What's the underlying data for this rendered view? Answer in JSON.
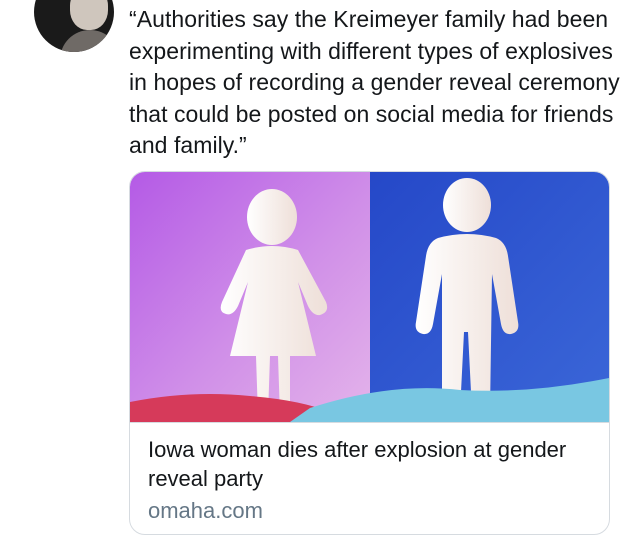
{
  "tweet": {
    "text": "“Authorities say the Kreimeyer family had been experimenting with different types of explosives in hopes of recording a gender reveal ceremony that could be posted on social media for friends and family.”"
  },
  "link_card": {
    "image_icon": "male-female-figures-image",
    "title": "Iowa woman dies after explosion at gender reveal party",
    "domain": "omaha.com"
  },
  "colors": {
    "text": "#14171a",
    "muted": "#657786",
    "card_border": "#d6dbe0",
    "image_left_bg": "#c06ee0",
    "image_right_bg": "#2c4fc4",
    "figure": "#f6ece6"
  }
}
